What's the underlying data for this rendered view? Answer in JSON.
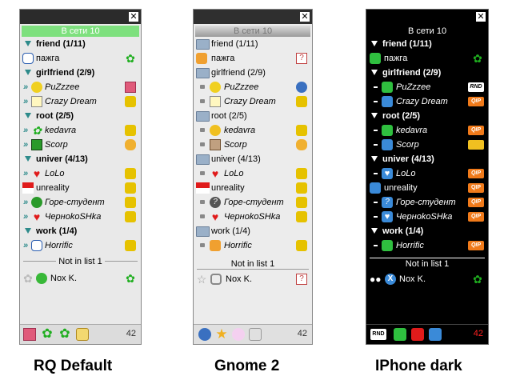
{
  "captions": [
    "RQ Default",
    "Gnome 2",
    "IPhone dark"
  ],
  "close_glyph": "✕",
  "online_header": "В сети 10",
  "not_in_list": "Not in list 1",
  "total_count": "42",
  "groups": [
    {
      "name": "friend (1/11)",
      "contacts": [
        "пажга"
      ]
    },
    {
      "name": "girlfriend (2/9)",
      "contacts": [
        "PuZzzee",
        "Crazy Dream"
      ]
    },
    {
      "name": "root (2/5)",
      "contacts": [
        "kedavra",
        "Scorp"
      ]
    },
    {
      "name": "univer (4/13)",
      "contacts": [
        "LoLo",
        "unreality",
        "Горе-студент",
        "ЧерноkoSHka"
      ]
    },
    {
      "name": "work (1/4)",
      "contacts": [
        "Horrific"
      ]
    }
  ],
  "nil_contact": "Nox K.",
  "colors": {
    "rq_header": "#7ee07e",
    "rq_group": "#2e8b8b",
    "iphone_count": "#ff2020",
    "icq_green": "#1fae1f",
    "heart_red": "#e01b1b"
  },
  "icons": {
    "status_client": "client-icon",
    "status_icq": "icq-flower-icon",
    "status_heart": "heart-icon",
    "folder": "folder-icon",
    "lock": "lock-icon",
    "rnd": "RND",
    "qip": "QIP"
  }
}
